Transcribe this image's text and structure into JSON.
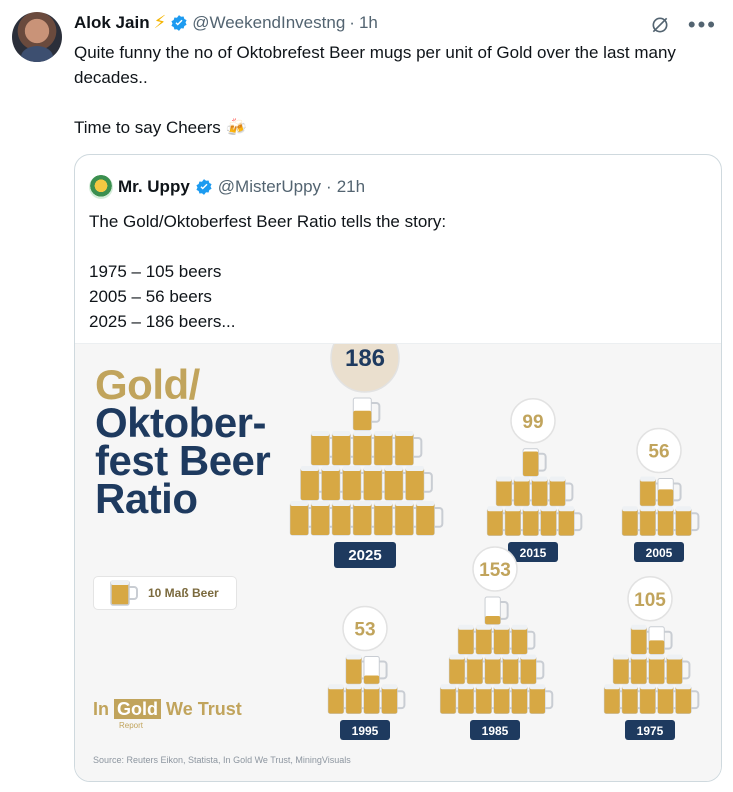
{
  "tweet": {
    "author_name": "Alok Jain",
    "author_handle": "@WeekendInvestng",
    "separator": "·",
    "time": "1h",
    "text": "Quite funny the no of Oktobrefest Beer mugs per unit of Gold over the last many decades..\n\nTime to say Cheers 🍻"
  },
  "quote": {
    "author_name": "Mr. Uppy",
    "author_handle": "@MisterUppy",
    "separator": "·",
    "time": "21h",
    "text": "The Gold/Oktoberfest Beer Ratio tells the story:\n\n1975 – 105 beers\n2005 – 56 beers\n2025 – 186 beers..."
  },
  "infographic": {
    "title_gold": "Gold/",
    "title_rest": "Oktober-\nfest Beer\nRatio",
    "legend_text": "10 Maß Beer",
    "brand_in": "In",
    "brand_gold": "Gold",
    "brand_trust": "We Trust",
    "brand_report": "Report",
    "source": "Source: Reuters Eikon, Statista, In Gold We Trust, MiningVisuals"
  },
  "chart_data": {
    "type": "bar",
    "title": "Gold/Oktoberfest Beer Ratio",
    "unit_note": "10 Maß Beer",
    "categories": [
      "2025",
      "2015",
      "2005",
      "1995",
      "1985",
      "1975"
    ],
    "values": [
      186,
      99,
      56,
      53,
      153,
      105
    ]
  },
  "colors": {
    "navy": "#1e3a5f",
    "gold": "#c1a45c",
    "beer": "#d7a844",
    "foam": "#eef1f4",
    "glass": "#c9cdd3"
  }
}
